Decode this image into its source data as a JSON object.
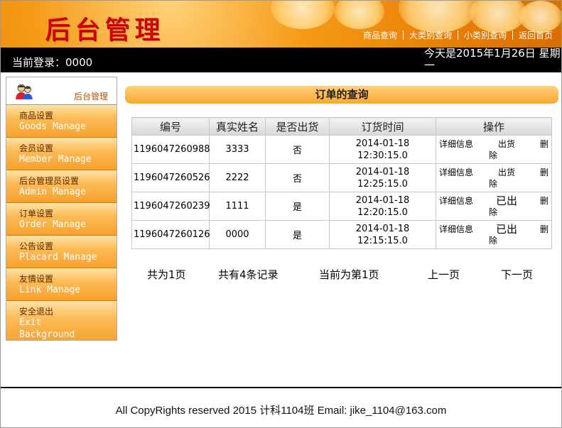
{
  "header": {
    "title": "后台管理",
    "nav": [
      "商品查询",
      "大类别查询",
      "小类别查询",
      "返回首页"
    ]
  },
  "status": {
    "login": "当前登录：0000",
    "today": "今天是2015年1月26日  星期一"
  },
  "sidebar": {
    "title": "后台管理",
    "items": [
      {
        "cn": "商品设置",
        "en": "Goods Manage"
      },
      {
        "cn": "会员设置",
        "en": "Member Manage"
      },
      {
        "cn": "后台管理员设置",
        "en": "Admin Manage"
      },
      {
        "cn": "订单设置",
        "en": "Order Manage"
      },
      {
        "cn": "公告设置",
        "en": "Placard Manage"
      },
      {
        "cn": "友情设置",
        "en": "Link Manage"
      },
      {
        "cn": "安全退出",
        "en": "Exit Background"
      }
    ]
  },
  "main": {
    "section_title": "订单的查询",
    "columns": [
      "编号",
      "真实姓名",
      "是否出货",
      "订货时间",
      "操作"
    ],
    "rows": [
      {
        "id": "1196047260988",
        "name": "3333",
        "shipped": "否",
        "time_date": "2014-01-18",
        "time_clock": "12:30:15.0",
        "detail": "详细信息",
        "ship_action": "出货",
        "delete_a": "删",
        "delete_b": "除"
      },
      {
        "id": "1196047260526",
        "name": "2222",
        "shipped": "否",
        "time_date": "2014-01-18",
        "time_clock": "12:25:15.0",
        "detail": "详细信息",
        "ship_action": "出货",
        "delete_a": "删",
        "delete_b": "除"
      },
      {
        "id": "1196047260239",
        "name": "1111",
        "shipped": "是",
        "time_date": "2014-01-18",
        "time_clock": "12:20:15.0",
        "detail": "详细信息",
        "ship_action": "已出",
        "delete_a": "删",
        "delete_b": "除"
      },
      {
        "id": "1196047260126",
        "name": "0000",
        "shipped": "是",
        "time_date": "2014-01-18",
        "time_clock": "12:15:15.0",
        "detail": "详细信息",
        "ship_action": "已出",
        "delete_a": "删",
        "delete_b": "除"
      }
    ],
    "pager": {
      "total_pages": "共为1页",
      "total_records": "共有4条记录",
      "current": "当前为第1页",
      "prev": "上一页",
      "next": "下一页"
    }
  },
  "footer": {
    "copyright": "All CopyRights reserved 2015 计科1104班 Email: jike_1104@163.com"
  },
  "colors": {
    "banner_orange": "#ea7f06",
    "title_red": "#e00000",
    "sidebar_orange": "#f7a02e"
  }
}
